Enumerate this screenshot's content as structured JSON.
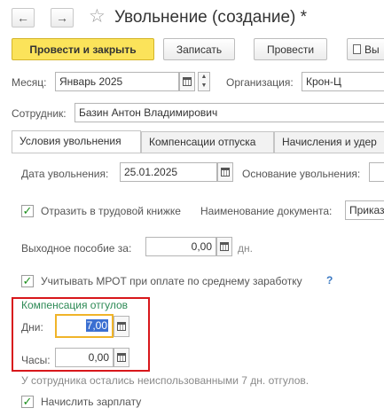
{
  "window": {
    "title": "Увольнение (создание) *",
    "back_icon": "arrow-left-icon",
    "forward_icon": "arrow-right-icon",
    "favorite_icon": "star-icon"
  },
  "toolbar": {
    "post_and_close": "Провести и закрыть",
    "save": "Записать",
    "post": "Провести",
    "more": "Вы"
  },
  "header": {
    "month_label": "Месяц:",
    "month_value": "Январь 2025",
    "org_label": "Организация:",
    "org_value": "Крон-Ц",
    "employee_label": "Сотрудник:",
    "employee_value": "Базин Антон Владимирович"
  },
  "tabs": [
    {
      "label": "Условия увольнения",
      "active": true
    },
    {
      "label": "Компенсации отпуска",
      "active": false
    },
    {
      "label": "Начисления и удер",
      "active": false
    }
  ],
  "conditions": {
    "dismissal_date_label": "Дата увольнения:",
    "dismissal_date_value": "25.01.2025",
    "basis_label": "Основание увольнения:",
    "workbook_checkbox_label": "Отразить в трудовой книжке",
    "workbook_checked": true,
    "doc_name_label": "Наименование документа:",
    "doc_name_value": "Приказ",
    "severance_label": "Выходное пособие за:",
    "severance_value": "0,00",
    "severance_unit": "дн.",
    "mrot_checkbox_label": "Учитывать МРОТ при оплате по среднему заработку",
    "mrot_checked": true,
    "help_mark": "?"
  },
  "time_off_compensation": {
    "group_title": "Компенсация отгулов",
    "days_label": "Дни:",
    "days_value": "7,00",
    "hours_label": "Часы:",
    "hours_value": "0,00",
    "note": "У сотрудника остались неиспользованными 7 дн. отгулов."
  },
  "payroll": {
    "calc_checkbox_label": "Начислить зарплату",
    "calc_checked": true
  },
  "colors": {
    "primary_button": "#fbe35a",
    "highlight_border": "#d8171b",
    "group_title": "#2d8a55",
    "focus_border": "#f0b429",
    "selection": "#3b6fd1"
  }
}
